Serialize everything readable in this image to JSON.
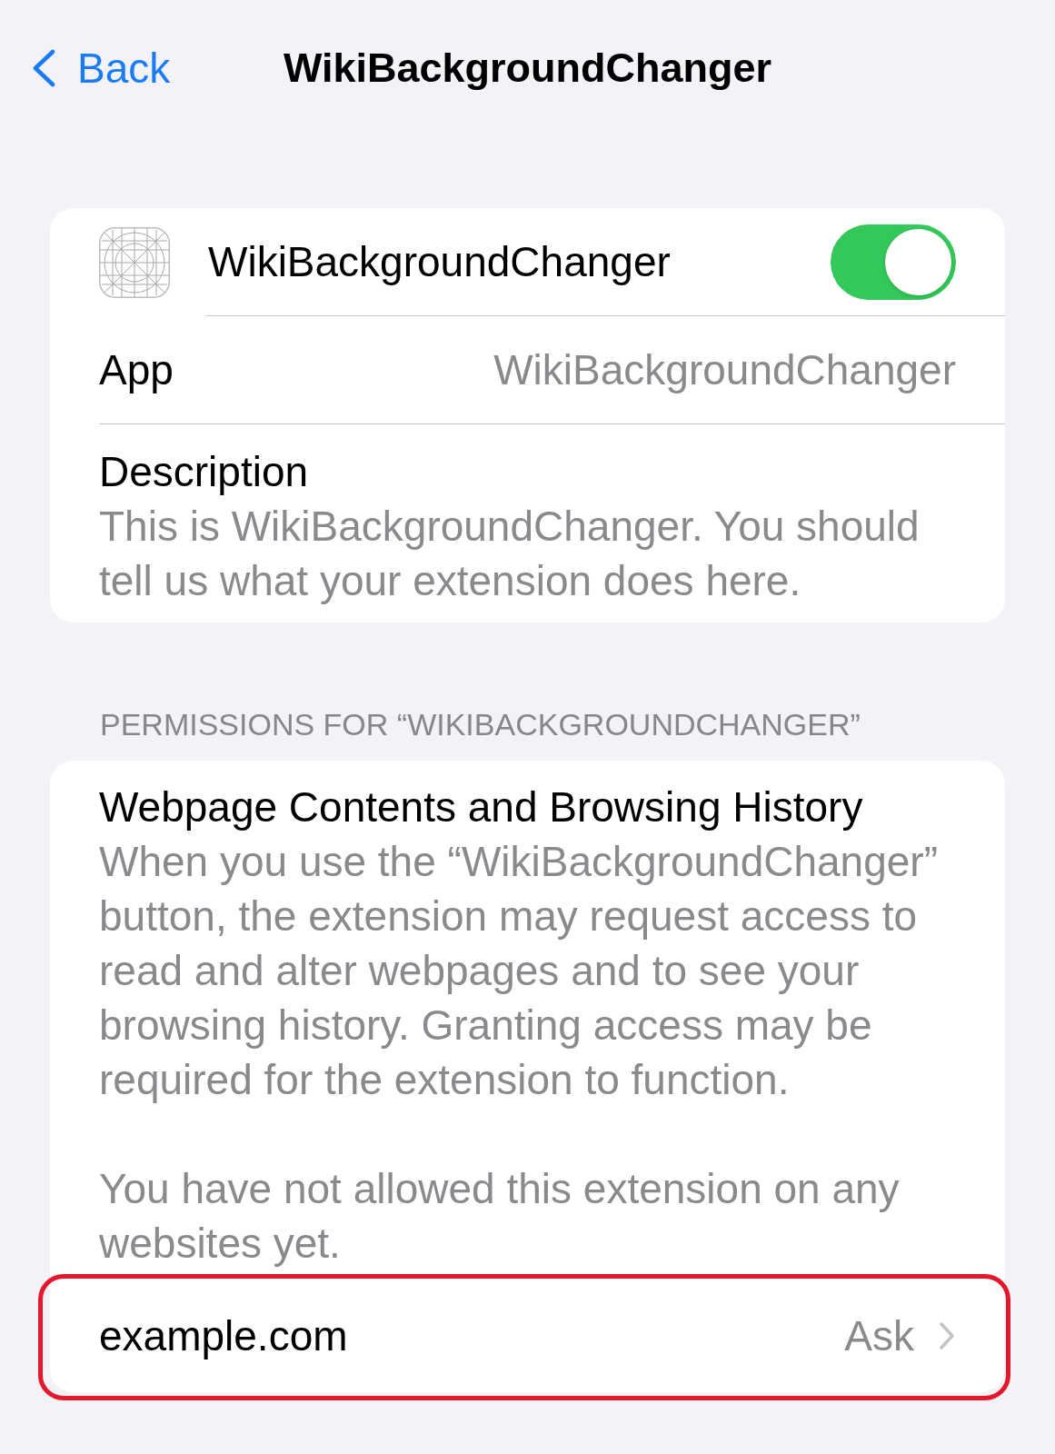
{
  "nav": {
    "back_label": "Back",
    "title": "WikiBackgroundChanger"
  },
  "app_card": {
    "rows": [
      {
        "kind": "toggle",
        "label": "WikiBackgroundChanger",
        "on": true
      },
      {
        "kind": "value",
        "label": "App",
        "value": "WikiBackgroundChanger"
      },
      {
        "kind": "description",
        "label": "Description",
        "text": "This is WikiBackgroundChanger. You should tell us what your extension does here."
      }
    ]
  },
  "permissions": {
    "header": "PERMISSIONS FOR “WIKIBACKGROUNDCHANGER”",
    "title": "Webpage Contents and Browsing History",
    "paragraphs": [
      "When you use the “WikiBackgroundChanger” button, the extension may request access to read and alter webpages and to see your browsing history. Granting access may be required for the extension to function.",
      "You have not allowed this extension on any websites yet."
    ],
    "sites": [
      {
        "label": "example.com",
        "value": "Ask",
        "highlighted": true
      }
    ]
  }
}
